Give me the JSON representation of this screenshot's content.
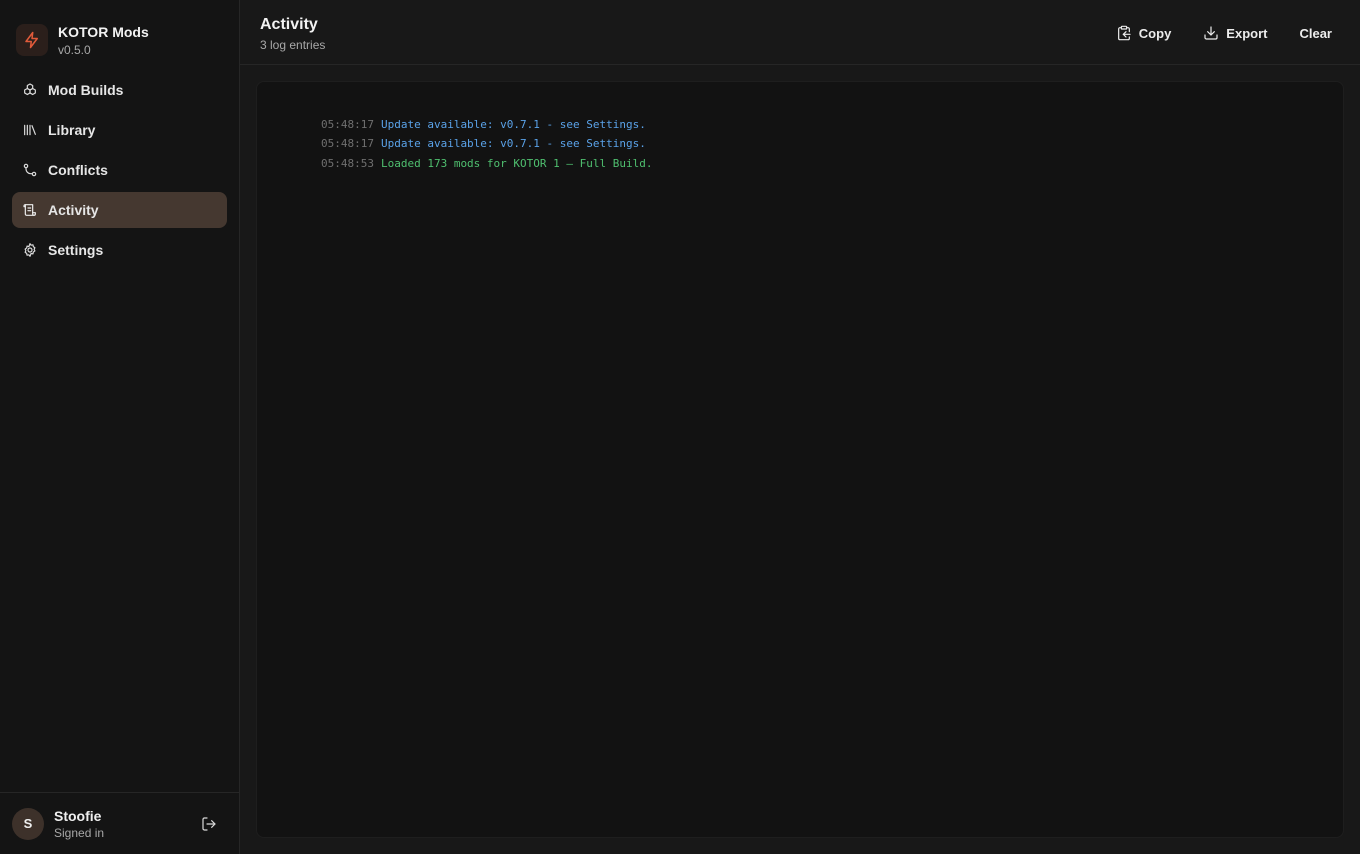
{
  "app": {
    "name": "KOTOR Mods",
    "version": "v0.5.0"
  },
  "nav": {
    "items": [
      {
        "label": "Mod Builds",
        "icon": "boxes-icon",
        "active": false
      },
      {
        "label": "Library",
        "icon": "library-icon",
        "active": false
      },
      {
        "label": "Conflicts",
        "icon": "git-branch-icon",
        "active": false
      },
      {
        "label": "Activity",
        "icon": "scroll-log-icon",
        "active": true
      },
      {
        "label": "Settings",
        "icon": "gear-icon",
        "active": false
      }
    ]
  },
  "user": {
    "initial": "S",
    "name": "Stoofie",
    "status": "Signed in"
  },
  "header": {
    "title": "Activity",
    "subtitle": "3 log entries",
    "copy_label": "Copy",
    "export_label": "Export",
    "clear_label": "Clear"
  },
  "log": {
    "entries": [
      {
        "time": "05:48:17",
        "message": "Update available: v0.7.1 - see Settings.",
        "level": "info"
      },
      {
        "time": "05:48:17",
        "message": "Update available: v0.7.1 - see Settings.",
        "level": "info"
      },
      {
        "time": "05:48:53",
        "message": "Loaded 173 mods for KOTOR 1 — Full Build.",
        "level": "success"
      }
    ]
  },
  "colors": {
    "accent": "#e05a3a",
    "active_nav_bg": "#453830",
    "info": "#5aa2e8",
    "success": "#4fbf6f"
  }
}
